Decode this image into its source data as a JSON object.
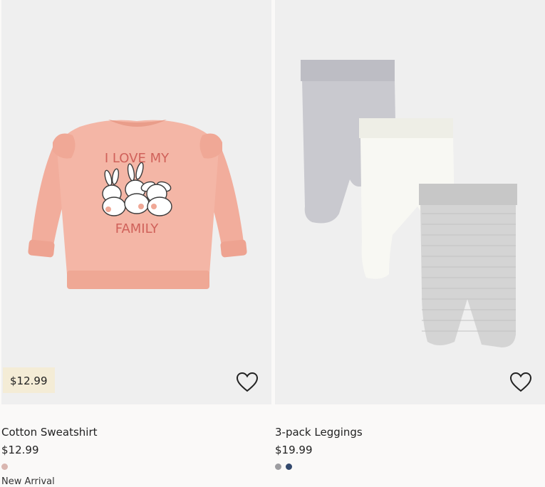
{
  "products": [
    {
      "name": "Cotton Sweatshirt",
      "price": "$12.99",
      "price_badge": "$12.99",
      "graphic_text": [
        "I LOVE MY",
        "FAMILY"
      ],
      "swatches": [
        {
          "color": "#d9b6b0",
          "name": "light pink"
        }
      ],
      "marker": "New Arrival"
    },
    {
      "name": "3-pack Leggings",
      "price": "$19.99",
      "swatches": [
        {
          "color": "#9d9da1",
          "name": "grey"
        },
        {
          "color": "#33496d",
          "name": "dark blue"
        }
      ]
    }
  ],
  "icons": {
    "favorite": "heart-outline-icon"
  },
  "colors": {
    "page_bg": "#faf9f8",
    "image_bg": "#efefef",
    "price_badge_bg": "#f4ecd6",
    "sweatshirt_pink": "#f4b6a6",
    "graphic_text_red": "#d0615a"
  }
}
